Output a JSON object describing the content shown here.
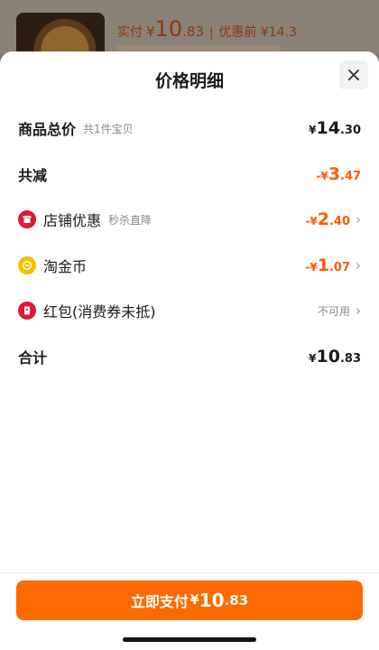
{
  "background": {
    "paid_label": "实付",
    "paid_yen": "¥",
    "paid_int": "10",
    "paid_dec": ".83",
    "separator": "|",
    "original_label": "优惠前 ¥14.3"
  },
  "sheet": {
    "title": "价格明细",
    "close_icon": "×"
  },
  "rows": {
    "total": {
      "label": "商品总价",
      "sub": "共1件宝贝",
      "yen": "¥",
      "int": "14",
      "dec": ".30"
    },
    "reduction": {
      "label": "共减",
      "yen": "-¥",
      "int": "3",
      "dec": ".47"
    },
    "shop": {
      "label": "店铺优惠",
      "sub": "秒杀直降",
      "yen": "-¥",
      "int": "2",
      "dec": ".40",
      "icon": "shop-icon"
    },
    "coin": {
      "label": "淘金币",
      "yen": "-¥",
      "int": "1",
      "dec": ".07",
      "icon": "coin-icon"
    },
    "redpack": {
      "label": "红包(消费券未抵)",
      "status": "不可用",
      "icon": "red-packet-icon"
    },
    "sum": {
      "label": "合计",
      "yen": "¥",
      "int": "10",
      "dec": ".83"
    }
  },
  "chevron": "›",
  "pay_button": {
    "label": "立即支付",
    "yen": "¥",
    "int": "10",
    "dec": ".83"
  },
  "colors": {
    "accent": "#ff6a00",
    "discount": "#ff5a00",
    "shop_icon": "#e0183a",
    "coin_icon": "#f2c200"
  }
}
